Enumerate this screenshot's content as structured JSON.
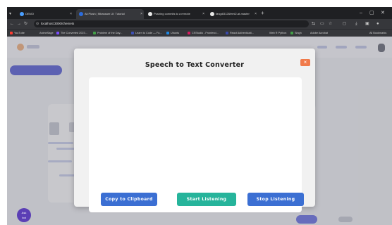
{
  "browser": {
    "tabs": [
      {
        "label": "DEMO",
        "active": false,
        "color": "#4a9fff"
      },
      {
        "label": "Ali Plash | Mbassam UI: Tutorial",
        "active": true,
        "color": "#2b6cde"
      },
      {
        "label": "Pushing commits to a remote",
        "active": false,
        "color": "#e8e8e8"
      },
      {
        "label": "fangdi3128/eml2-at-master",
        "active": false,
        "color": "#e8e8e8"
      }
    ],
    "url": "localhost:3000/chemets",
    "bookmarks": [
      {
        "label": "YouTube",
        "color": "#ff3b30"
      },
      {
        "label": "AnimeSage",
        "color": "#e0e0e0"
      },
      {
        "label": "The Converted 2023...",
        "color": "#7b4dff"
      },
      {
        "label": "Problem of the Day...",
        "color": "#43a047"
      },
      {
        "label": "Learn to Code — Fo...",
        "color": "#3f51b5"
      },
      {
        "label": "Ubuntu",
        "color": "#1e88e5"
      },
      {
        "label": "CSStudio - Frontend...",
        "color": "#d81b60"
      },
      {
        "label": "React Authenticati...",
        "color": "#3949ab"
      },
      {
        "label": "Web R Python",
        "color": "#e0e0e0"
      },
      {
        "label": "Singh",
        "color": "#43a047"
      },
      {
        "label": "Adobe Acrobat",
        "color": "#e0e0e0"
      },
      {
        "label": "All Bookmarks",
        "color": "#e0e0e0"
      }
    ]
  },
  "help_fab": {
    "label": "Ask\nbot"
  },
  "modal": {
    "title": "Speech to Text Converter",
    "close_label": "×",
    "transcript_text": "",
    "buttons": {
      "copy": "Copy to Clipboard",
      "start": "Start Listening",
      "stop": "Stop Listening"
    }
  }
}
